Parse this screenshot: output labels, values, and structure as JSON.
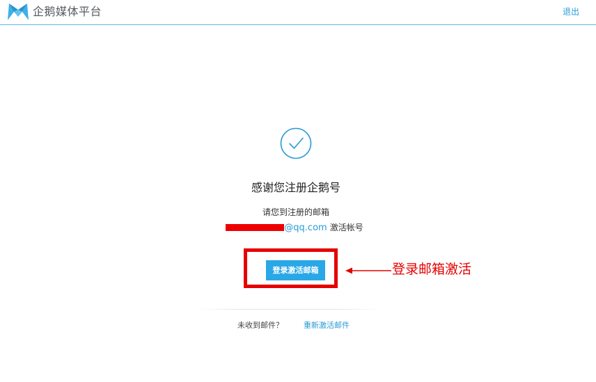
{
  "header": {
    "logo_text": "企鹅媒体平台",
    "logout_label": "退出"
  },
  "main": {
    "title": "感谢您注册企鹅号",
    "instruction": "请您到注册的邮箱",
    "email_visible": "@qq.com",
    "email_suffix_text": "激活帐号",
    "activate_button_label": "登录激活邮箱",
    "annotation_text": "登录邮箱激活",
    "footer_question": "未收到邮件？",
    "resend_link_label": "重新激活邮件"
  },
  "colors": {
    "accent": "#2aa7e6",
    "link": "#2a9bd6",
    "annotation": "#e60000",
    "redaction": "#ee0000"
  },
  "icons": {
    "logo": "qie-logo-icon",
    "success": "check-circle-icon",
    "annotation_arrow": "arrow-left-icon"
  }
}
